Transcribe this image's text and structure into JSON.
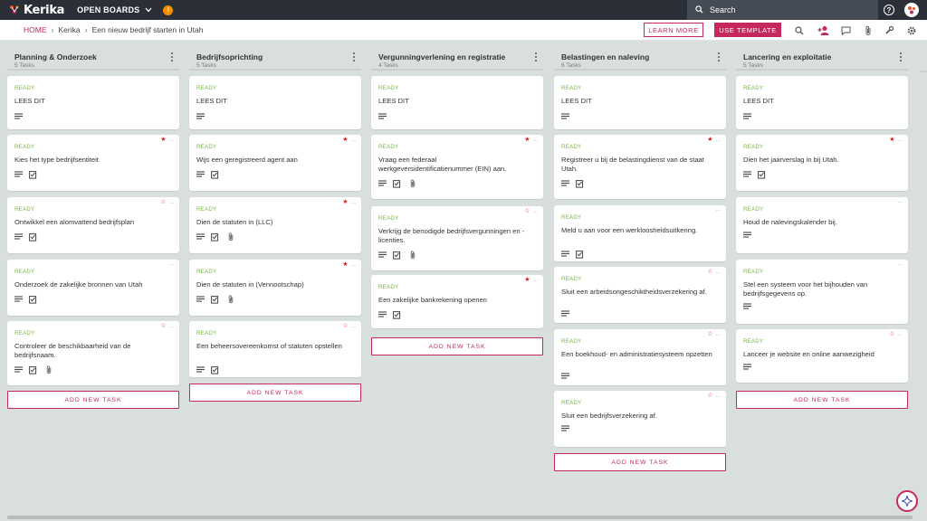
{
  "app": {
    "brand": "Kerika",
    "open_boards": "OPEN BOARDS",
    "notification_count": "!"
  },
  "search": {
    "label": "Search"
  },
  "help": {
    "label": "?"
  },
  "breadcrumb": {
    "home": "HOME",
    "org": "Kerika",
    "board": "Een nieuw bedrijf starten in Utah"
  },
  "actions": {
    "learn_more": "LEARN MORE",
    "use_template": "USE TEMPLATE"
  },
  "colors": {
    "accent": "#c4285f",
    "ready": "#7ab648",
    "star": "#e02020",
    "topbar": "#2b3038"
  },
  "add_task_label": "ADD NEW TASK",
  "columns": [
    {
      "title": "Planning & Onderzoek",
      "count": "5 Tasks",
      "cards": [
        {
          "status": "READY",
          "title": "LEES DIT",
          "star": "none",
          "icons": [
            "lines"
          ]
        },
        {
          "status": "READY",
          "title": "Kies het type bedrijfsentiteit",
          "star": "filled",
          "icons": [
            "lines",
            "checklist"
          ],
          "checklist": "4"
        },
        {
          "status": "READY",
          "title": "Ontwikkel een alomvattend bedrijfsplan",
          "star": "empty",
          "icons": [
            "lines",
            "checklist"
          ],
          "checklist": "4"
        },
        {
          "status": "READY",
          "title": "Onderzoek de zakelijke bronnen van Utah",
          "star": "none",
          "icons": [
            "lines",
            "checklist"
          ],
          "checklist": "3"
        },
        {
          "status": "READY",
          "title": "Controleer de beschikbaarheid van de bedrijfsnaam.",
          "star": "empty",
          "icons": [
            "lines",
            "checklist",
            "clip"
          ],
          "checklist": "4"
        }
      ]
    },
    {
      "title": "Bedrijfsoprichting",
      "count": "5 Tasks",
      "cards": [
        {
          "status": "READY",
          "title": "LEES DIT",
          "star": "none",
          "icons": [
            "lines"
          ]
        },
        {
          "status": "READY",
          "title": "Wijs een geregistreerd agent aan",
          "star": "filled",
          "icons": [
            "lines",
            "checklist"
          ],
          "checklist": "4"
        },
        {
          "status": "READY",
          "title": "Dien de statuten in (LLC)",
          "star": "filled",
          "icons": [
            "lines",
            "checklist",
            "clip"
          ],
          "checklist": "5"
        },
        {
          "status": "READY",
          "title": "Dien de statuten in (Vennootschap)",
          "star": "filled",
          "icons": [
            "lines",
            "checklist",
            "clip"
          ],
          "checklist": "5"
        },
        {
          "status": "READY",
          "title": "Een beheersovereenkomst of statuten opstellen",
          "star": "empty",
          "icons": [
            "lines",
            "checklist"
          ],
          "checklist": "4"
        }
      ]
    },
    {
      "title": "Vergunningverlening en registratie",
      "count": "4 Tasks",
      "cards": [
        {
          "status": "READY",
          "title": "LEES DIT",
          "star": "none",
          "icons": [
            "lines"
          ]
        },
        {
          "status": "READY",
          "title": "Vraag een federaal werkgeversidentificatienummer (EIN) aan.",
          "star": "filled",
          "icons": [
            "lines",
            "checklist",
            "clip"
          ],
          "checklist": "4"
        },
        {
          "status": "READY",
          "title": "Verkrijg de benodigde bedrijfsvergunningen en -licenties.",
          "star": "empty",
          "icons": [
            "lines",
            "checklist",
            "clip"
          ],
          "checklist": "4"
        },
        {
          "status": "READY",
          "title": "Een zakelijke bankrekening openen",
          "star": "filled",
          "icons": [
            "lines",
            "checklist"
          ],
          "checklist": "4"
        }
      ]
    },
    {
      "title": "Belastingen en naleving",
      "count": "6 Tasks",
      "cards": [
        {
          "status": "READY",
          "title": "LEES DIT",
          "star": "none",
          "icons": [
            "lines"
          ]
        },
        {
          "status": "READY",
          "title": "Registreer u bij de belastingdienst van de staat Utah.",
          "star": "filled",
          "icons": [
            "lines",
            "checklist"
          ],
          "checklist": "4"
        },
        {
          "status": "READY",
          "title": "Meld u aan voor een werkloosheidsuitkering.",
          "star": "none",
          "icons": [
            "lines",
            "checklist"
          ],
          "checklist": "3"
        },
        {
          "status": "READY",
          "title": "Sluit een arbeidsongeschiktheidsverzekering af.",
          "star": "empty",
          "icons": [
            "lines"
          ]
        },
        {
          "status": "READY",
          "title": "Een boekhoud- en administratiesysteem opzetten",
          "star": "empty",
          "icons": [
            "lines"
          ]
        },
        {
          "status": "READY",
          "title": "Sluit een bedrijfsverzekering af.",
          "star": "empty",
          "icons": [
            "lines"
          ]
        }
      ]
    },
    {
      "title": "Lancering en exploitatie",
      "count": "5 Tasks",
      "cards": [
        {
          "status": "READY",
          "title": "LEES DIT",
          "star": "none",
          "icons": [
            "lines"
          ]
        },
        {
          "status": "READY",
          "title": "Dien het jaarverslag in bij Utah.",
          "star": "filled",
          "icons": [
            "lines",
            "checklist"
          ],
          "checklist": "4"
        },
        {
          "status": "READY",
          "title": "Houd de nalevingskalender bij.",
          "star": "none",
          "icons": [
            "lines"
          ]
        },
        {
          "status": "READY",
          "title": "Stel een systeem voor het bijhouden van bedrijfsgegevens op.",
          "star": "none",
          "icons": [
            "lines"
          ]
        },
        {
          "status": "READY",
          "title": "Lanceer je website en online aanwezigheid",
          "star": "empty",
          "icons": [
            "lines"
          ]
        }
      ]
    }
  ]
}
